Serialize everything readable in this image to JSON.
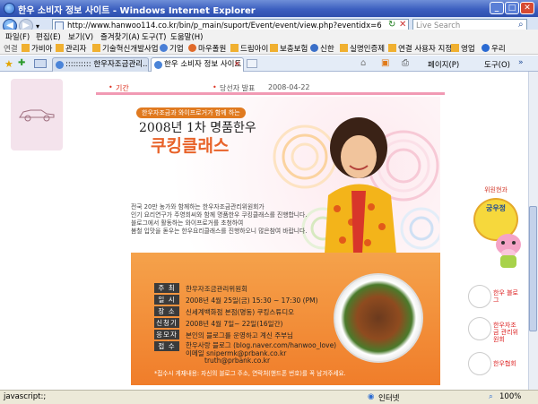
{
  "window": {
    "title": "한우 소비자 정보 사이트 - Windows Internet Explorer"
  },
  "address": {
    "url": "http://www.hanwoo114.co.kr/bin/p_main/suport/Event/event/view.php?eventidx=6",
    "search_placeholder": "Live Search"
  },
  "menu": [
    "파일(F)",
    "편집(E)",
    "보기(V)",
    "즐겨찾기(A)",
    "도구(T)",
    "도움말(H)"
  ],
  "links": {
    "label": "연결",
    "items": [
      "가비아",
      "관리자",
      "기술혁신개발사업",
      "기업",
      "마우폴원",
      "드림아이",
      "보충보험",
      "신한",
      "실명인증제",
      "연결 사용자 지정",
      "영업",
      "우리"
    ]
  },
  "tabs": [
    {
      "label": ":::::::::: 한우자조금관리..."
    },
    {
      "label": "한우 소비자 정보 사이트"
    }
  ],
  "commands": {
    "page": "페이지(P)",
    "tools": "도구(O)"
  },
  "event": {
    "period_label": "기간",
    "period_value": "",
    "announce_label": "당선자 발표",
    "announce_date": "2008-04-22",
    "banner_tag": "한우자조금과 와이프로거가 함께 하는",
    "year_title": "2008년 1차  명품한우",
    "main_title": "쿠킹클래스",
    "intro": [
      "전국 20만 농가와 함께하는 한우자조금관리위원회가",
      "인기 요리연구가 주영희씨와 함께 명품한우 쿠킹클래스를 진행합니다.",
      "블로그에서 활동하는 와이프로거를 초청하여",
      "봄철 입맛을 돋우는 한우요리클래스를 진행하오니 많은참여 바랍니다."
    ],
    "rows": [
      {
        "label": "주 최",
        "value": "한우자조금관리위원회"
      },
      {
        "label": "일 시",
        "value": "2008년 4월 25일(금) 15:30 ~ 17:30 (PM)"
      },
      {
        "label": "장 소",
        "value": "신세계백화점 본점(명동) 쿠킹스튜디오"
      },
      {
        "label": "신청기간",
        "value": "2008년 4월 7일~ 22일(16일간)"
      },
      {
        "label": "응모자격",
        "value": "본인의 블로그를 운영하고 계신 주부님"
      },
      {
        "label": "접 수",
        "value": "한우사랑 블로그 (blog.naver.com/hanwoo_love)"
      }
    ],
    "contact_lines": [
      "이메일  snipermk@prbank.co.kr",
      "truth@prbank.co.kr"
    ],
    "footnote": "*접수시 게재내용: 자신의 블로그 주소, 연락처(핸드폰 번호)를 꼭 남겨주세요."
  },
  "sidebar": {
    "card_top": "위원현과",
    "card_badge": "궁우정",
    "links": [
      "한우 블로그",
      "한우자조금 관리위원회",
      "한우협회"
    ]
  },
  "status": {
    "left": "javascript:;",
    "zone": "인터넷",
    "zoom": "100%"
  }
}
